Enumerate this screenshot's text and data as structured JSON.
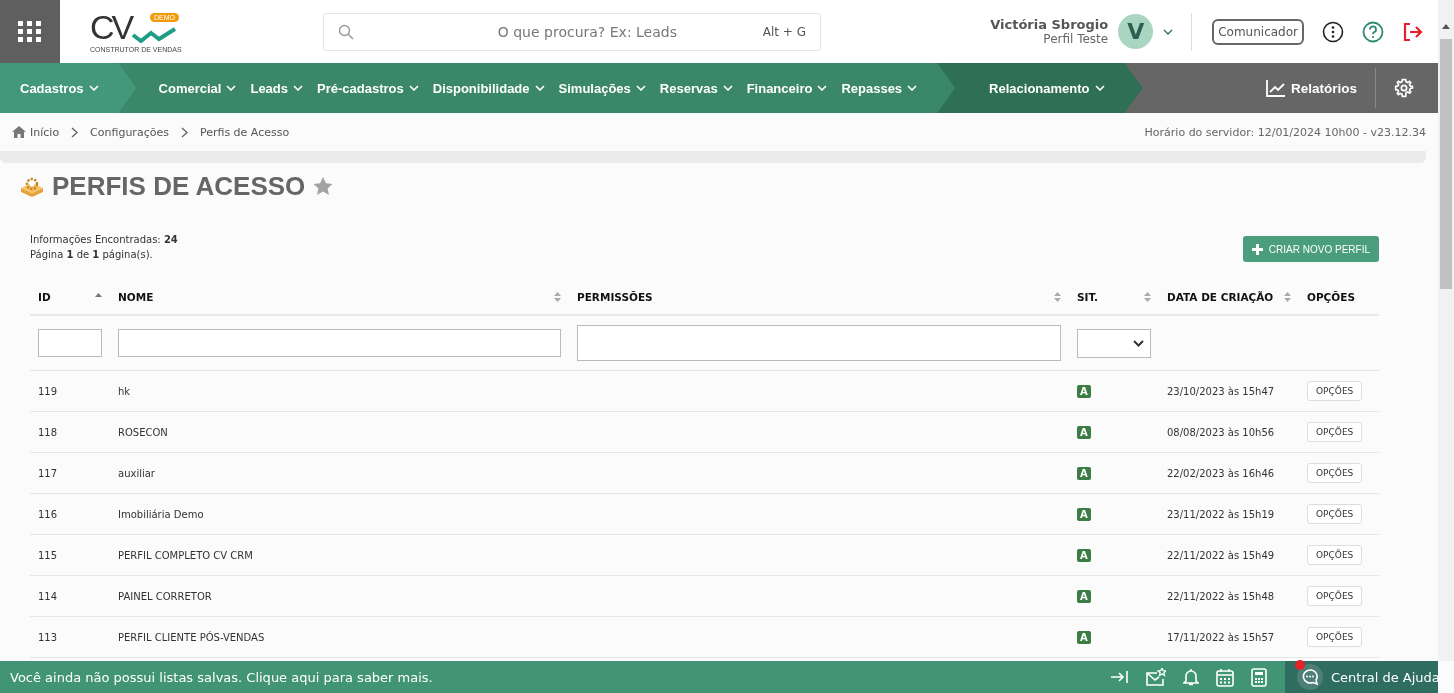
{
  "header": {
    "logo": {
      "mark": "CV",
      "badge": "DEMO",
      "tagline": "CONSTRUTOR DE VENDAS"
    },
    "search": {
      "placeholder": "O que procura? Ex: Leads",
      "shortcut": "Alt + G"
    },
    "user": {
      "name": "Victória Sbrogio",
      "profile": "Perfil Teste",
      "initial": "V"
    },
    "communicator": "Comunicador"
  },
  "nav": {
    "groups": [
      {
        "color": "#43977a",
        "items": [
          "Cadastros"
        ]
      },
      {
        "color": "#3a8869",
        "items": [
          "Comercial",
          "Leads",
          "Pré-cadastros",
          "Disponibilidade",
          "Simulações",
          "Reservas",
          "Financeiro",
          "Repasses"
        ]
      },
      {
        "color": "#2f6f55",
        "items": [
          "Relacionamento"
        ]
      }
    ],
    "reports": "Relatórios"
  },
  "breadcrumb": [
    "Início",
    "Configurações",
    "Perfis de Acesso"
  ],
  "server_info": "Horário do servidor: 12/01/2024 10h00 - v23.12.34",
  "page": {
    "title": "PERFIS DE ACESSO",
    "favorite": false,
    "found_label": "Informações Encontradas: **24**",
    "pages_label": "Página **1** de **1** página(s).",
    "create_button": "CRIAR NOVO PERFIL"
  },
  "table": {
    "columns": [
      {
        "label": "ID",
        "sortable": true,
        "sorted": true
      },
      {
        "label": "NOME",
        "sortable": true,
        "sorted": false
      },
      {
        "label": "PERMISSÕES",
        "sortable": true,
        "sorted": false
      },
      {
        "label": "SIT.",
        "sortable": true,
        "sorted": false
      },
      {
        "label": "DATA DE CRIAÇÃO",
        "sortable": true,
        "sorted": false
      },
      {
        "label": "OPÇÕES",
        "sortable": false
      }
    ],
    "filters": [
      {
        "kind": "text"
      },
      {
        "kind": "text"
      },
      {
        "kind": "textarea"
      },
      {
        "kind": "select"
      },
      {
        "kind": "none"
      },
      {
        "kind": "none"
      }
    ],
    "rows": [
      {
        "id": "119",
        "name": "hk",
        "status": "A",
        "created": "23/10/2023 às 15h47",
        "action": "OPÇÕES"
      },
      {
        "id": "118",
        "name": "ROSECON",
        "status": "A",
        "created": "08/08/2023 às 10h56",
        "action": "OPÇÕES"
      },
      {
        "id": "117",
        "name": "auxiliar",
        "status": "A",
        "created": "22/02/2023 às 16h46",
        "action": "OPÇÕES"
      },
      {
        "id": "116",
        "name": "Imobiliária Demo",
        "status": "A",
        "created": "23/11/2022 às 15h19",
        "action": "OPÇÕES"
      },
      {
        "id": "115",
        "name": "PERFIL COMPLETO CV CRM",
        "status": "A",
        "created": "22/11/2022 às 15h49",
        "action": "OPÇÕES"
      },
      {
        "id": "114",
        "name": "PAINEL CORRETOR",
        "status": "A",
        "created": "22/11/2022 às 15h48",
        "action": "OPÇÕES"
      },
      {
        "id": "113",
        "name": "PERFIL CLIENTE PÓS-VENDAS",
        "status": "A",
        "created": "17/11/2022 às 15h57",
        "action": "OPÇÕES"
      }
    ]
  },
  "bottom_bar": {
    "message": "Você ainda não possui listas salvas. Clique aqui para saber mais.",
    "help": "Central de Ajuda",
    "help_notification": true
  }
}
